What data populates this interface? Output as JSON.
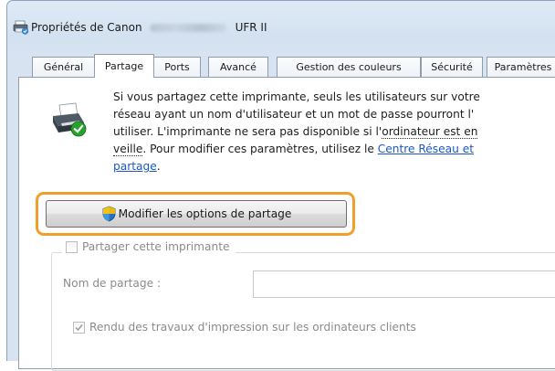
{
  "window": {
    "title_prefix": "Propriétés de Canon",
    "title_suffix": "UFR II"
  },
  "tabs": [
    {
      "label": "Général"
    },
    {
      "label": "Partage"
    },
    {
      "label": "Ports"
    },
    {
      "label": "Avancé"
    },
    {
      "label": "Gestion des couleurs"
    },
    {
      "label": "Sécurité"
    },
    {
      "label": "Paramètres"
    }
  ],
  "active_tab": "Partage",
  "info": {
    "line1": "Si vous partagez cette imprimante, seuls les utilisateurs sur votre",
    "line2": "réseau ayant un nom d'utilisateur et un mot de passe pourront l'",
    "line3_a": "utiliser. L'imprimante ne sera pas disponible si l'",
    "line3_b": "ordinateur est en",
    "line4_a": "veille",
    "line4_b": ". Pour modifier ces paramètres, utilisez le ",
    "link_a": "Centre Réseau et",
    "link_b": "partage",
    "line5_end": "."
  },
  "buttons": {
    "modify_sharing": "Modifier les options de partage"
  },
  "share_group": {
    "share_checkbox_label": "Partager cette imprimante",
    "share_checked": false,
    "share_name_label": "Nom de partage :",
    "share_name_value": "",
    "render_jobs_label": "Rendu des travaux d'impression sur les ordinateurs clients",
    "render_jobs_checked": true
  },
  "colors": {
    "highlight": "#f0a02a",
    "link": "#1a58c8",
    "disabled_text": "#8b8b8b"
  },
  "icons": {
    "title": "printer-properties-icon",
    "printer": "shared-printer-icon",
    "shield": "uac-shield-icon"
  }
}
